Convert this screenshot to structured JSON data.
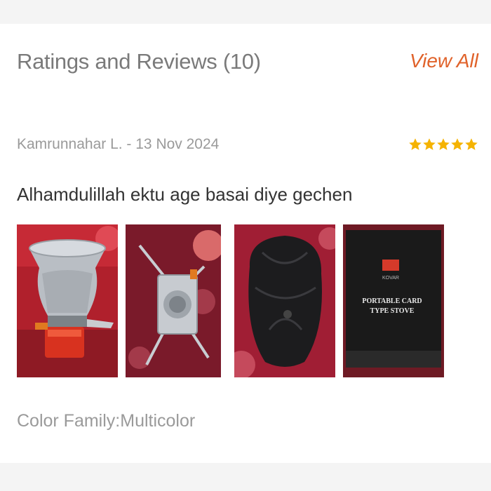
{
  "header": {
    "title": "Ratings and Reviews (10)",
    "view_all": "View All"
  },
  "review": {
    "author_date": "Kamrunnahar L. - 13 Nov 2024",
    "rating": 5,
    "rating_max": 5,
    "text": "Alhamdulillah ektu age basai diye gechen",
    "images": [
      {
        "name": "photo-pot-on-stove"
      },
      {
        "name": "photo-stove-top"
      },
      {
        "name": "photo-black-bag"
      },
      {
        "name": "photo-stove-box",
        "box_text_1": "PORTABLE CARD",
        "box_text_2": "TYPE STOVE",
        "brand": "KOVAR"
      }
    ],
    "attribute": "Color Family:Multicolor"
  },
  "colors": {
    "accent": "#e0622a",
    "star": "#f5b300"
  }
}
